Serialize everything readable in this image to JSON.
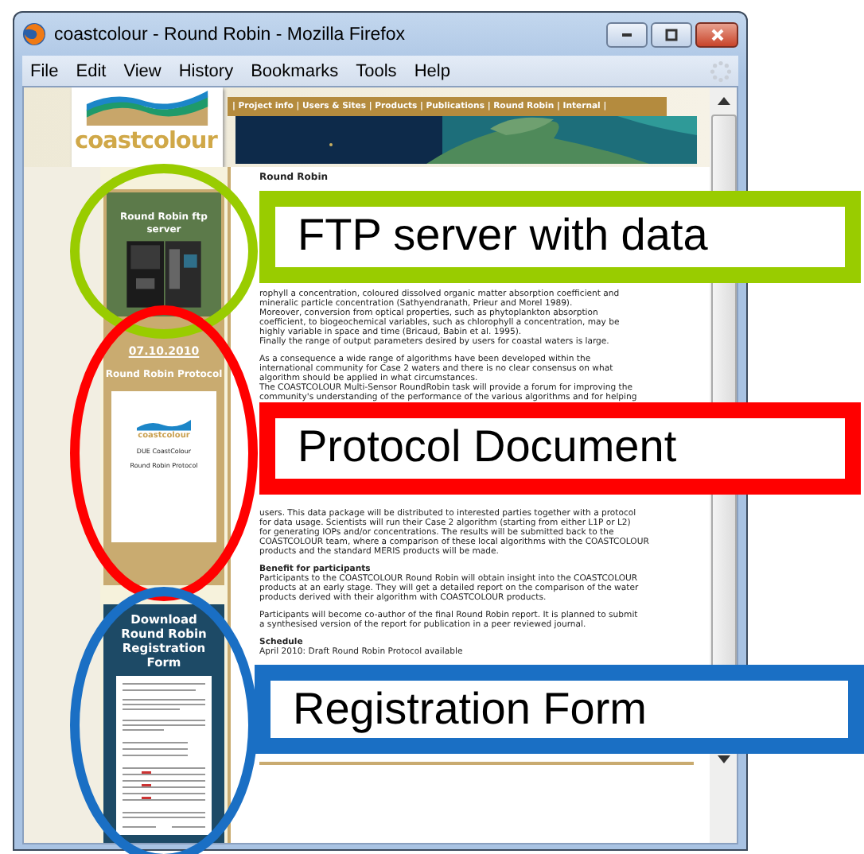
{
  "window": {
    "title": "coastcolour - Round Robin - Mozilla Firefox"
  },
  "menu": [
    "File",
    "Edit",
    "View",
    "History",
    "Bookmarks",
    "Tools",
    "Help"
  ],
  "page": {
    "logo": "coastcolour",
    "nav": "| Project info | Users & Sites | Products | Publications | Round Robin | Internal |",
    "sidebar": [
      {
        "kind": "ftp",
        "lines": [
          "Round Robin ftp",
          "server"
        ]
      },
      {
        "kind": "protocol",
        "date": "07.10.2010",
        "lines": [
          "Round Robin Protocol"
        ],
        "doc_logo": "coastcolour",
        "doc_lines": [
          "DUE CoastColour",
          "Round Robin Protocol"
        ]
      },
      {
        "kind": "registration",
        "lines": [
          "Download",
          "Round Robin",
          "Registration Form"
        ]
      }
    ],
    "heading": "Round Robin",
    "sections": [
      [
        {
          "kind": "text",
          "lines": [
            "rophyll a concentration, coloured dissolved organic matter absorption coefficient and",
            "mineralic particle concentration (Sathyendranath, Prieur and Morel 1989).",
            "Moreover, conversion from optical properties, such as phytoplankton absorption",
            "coefficient, to biogeochemical variables, such as chlorophyll a concentration, may be",
            "highly variable in space and time (Bricaud, Babin et al. 1995).",
            "Finally the range of output parameters desired by users for coastal waters is large."
          ]
        },
        {
          "kind": "text",
          "lines": [
            "As a consequence a wide range of algorithms have been developed within the",
            "international community for Case 2 waters and there is no clear consensus on what",
            "algorithm should be applied in what circumstances.",
            "The COASTCOLOUR Multi-Sensor RoundRobin task will provide a forum for improving the",
            "community's understanding of the performance of the various algorithms and for helping"
          ]
        }
      ],
      [
        {
          "kind": "text",
          "lines": [
            "users. This data package will be distributed to interested parties together with a protocol",
            "for data usage. Scientists will run their Case 2 algorithm (starting from either L1P or L2)",
            "for generating IOPs and/or concentrations. The results will be submitted back to the",
            "COASTCOLOUR team, where a comparison of these local algorithms with the COASTCOLOUR",
            "products and the standard MERIS products will be made."
          ]
        },
        {
          "kind": "heading",
          "lines": [
            "Benefit for participants"
          ]
        },
        {
          "kind": "text",
          "lines": [
            "Participants to the COASTCOLOUR Round Robin will obtain insight into the COASTCOLOUR",
            "products at an early stage. They will get a detailed report on the comparison of the water",
            "products derived with their algorithm with COASTCOLOUR products."
          ]
        },
        {
          "kind": "text",
          "lines": [
            "Participants will become co-author of the final Round Robin report. It is planned to submit",
            "a synthesised version of the report for publication in a peer reviewed journal."
          ]
        },
        {
          "kind": "heading",
          "lines": [
            "Schedule"
          ]
        },
        {
          "kind": "text",
          "lines": [
            "April 2010: Draft Round Robin Protocol available"
          ]
        }
      ]
    ]
  },
  "annotations": [
    {
      "text": "FTP server with data",
      "color": "#99cc00"
    },
    {
      "text": "Protocol Document",
      "color": "#ff0000"
    },
    {
      "text": "Registration Form",
      "color": "#1a6fc4"
    }
  ]
}
